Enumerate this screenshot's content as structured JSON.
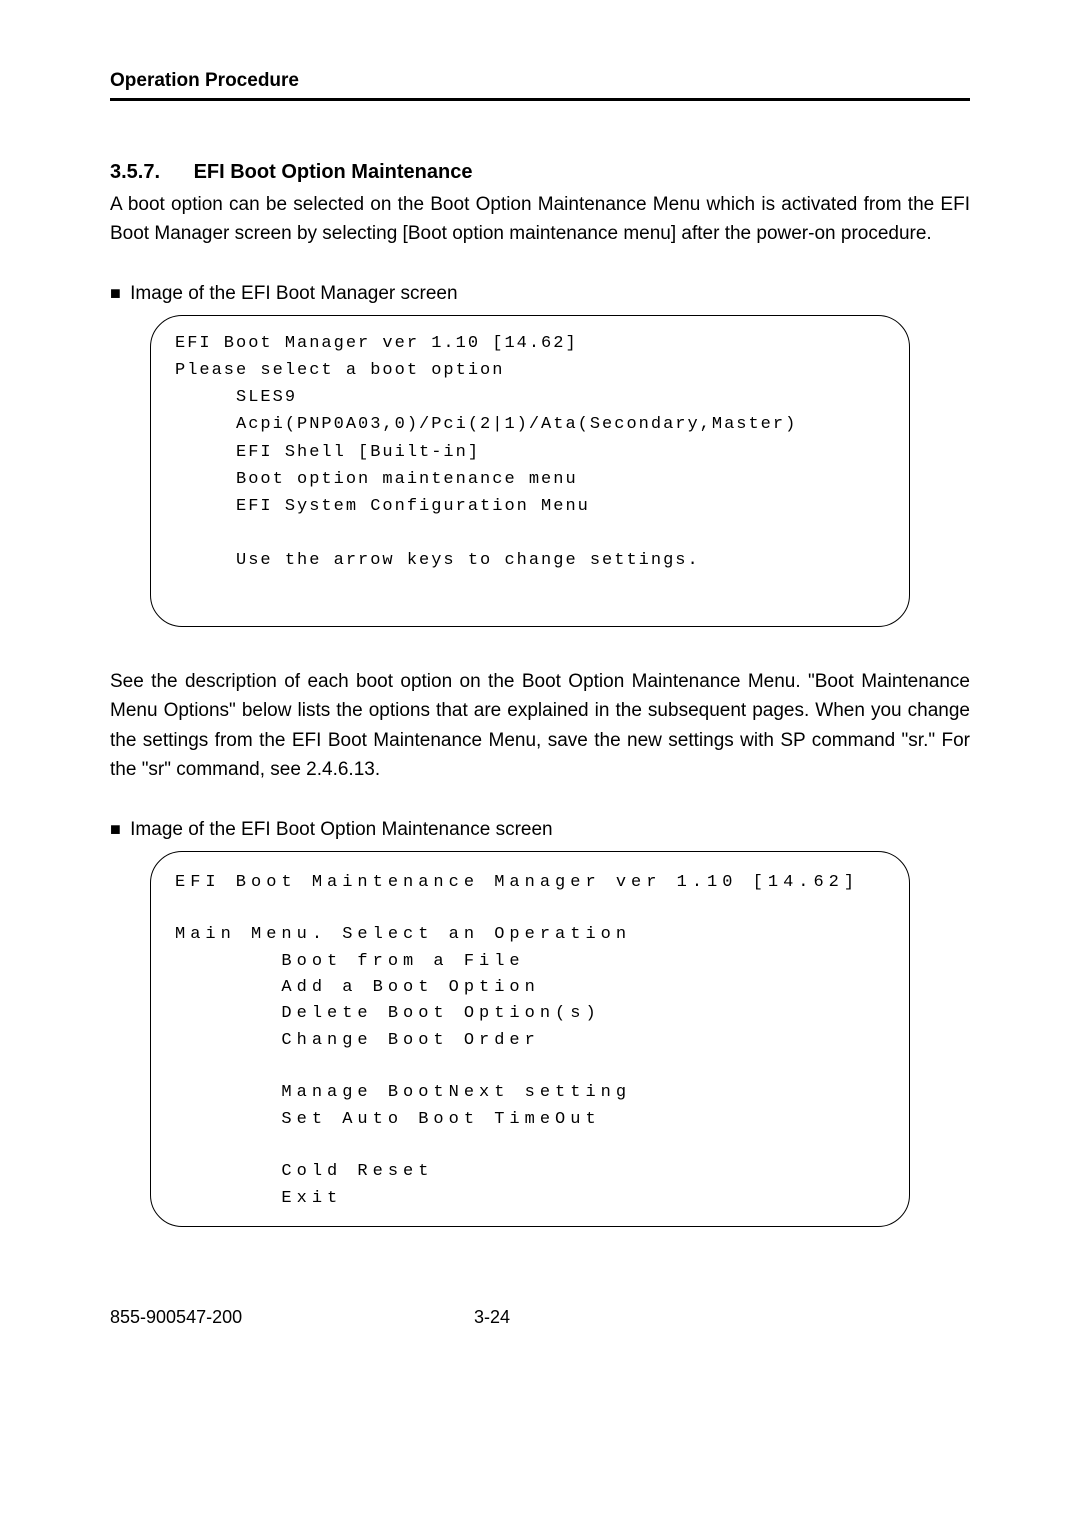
{
  "header": {
    "running": "Operation Procedure"
  },
  "section": {
    "num": "3.5.7.",
    "title": "EFI Boot Option Maintenance",
    "intro": "A boot option can be selected on the Boot Option Maintenance Menu which is activated from the EFI Boot Manager screen by selecting [Boot option maintenance menu] after the power-on procedure."
  },
  "caption1": "Image of the EFI Boot Manager screen",
  "screen1": {
    "l0": "EFI Boot Manager ver 1.10 [14.62]",
    "l1": "Please select a boot option",
    "l2": "     SLES9",
    "l3": "     Acpi(PNP0A03,0)/Pci(2|1)/Ata(Secondary,Master)",
    "l4": "     EFI Shell [Built-in]",
    "l5": "     Boot option maintenance menu",
    "l6": "     EFI System Configuration Menu",
    "l7": "     Use the arrow keys to change settings."
  },
  "middle": "See the description of each boot option on the Boot Option Maintenance Menu. \"Boot Maintenance Menu Options\" below lists the options that are explained in the subsequent pages. When you change the settings from the EFI Boot Maintenance Menu, save the new settings with SP command \"sr.\" For the \"sr\" command, see 2.4.6.13.",
  "caption2": "Image of the EFI Boot Option Maintenance screen",
  "screen2": {
    "l0": "EFI Boot Maintenance Manager ver 1.10 [14.62]",
    "l1": "Main Menu. Select an Operation",
    "l2": "       Boot from a File",
    "l3": "       Add a Boot Option",
    "l4": "       Delete Boot Option(s)",
    "l5": "       Change Boot Order",
    "l6": "       Manage BootNext setting",
    "l7": "       Set Auto Boot TimeOut",
    "l8": "       Cold Reset",
    "l9": "       Exit"
  },
  "footer": {
    "left": "855-900547-200",
    "right": "3-24"
  }
}
